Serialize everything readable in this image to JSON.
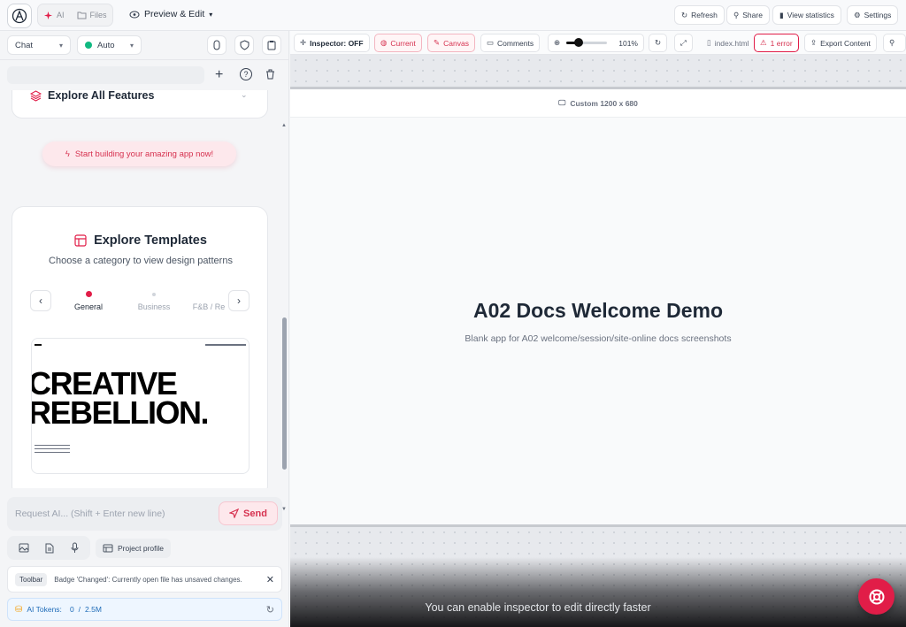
{
  "topbar": {
    "tabs": [
      "AI",
      "Files"
    ],
    "mode_label": "Preview & Edit",
    "actions": [
      "Refresh",
      "Share",
      "View statistics",
      "Settings"
    ]
  },
  "sidebar": {
    "chat_select": "Chat",
    "model_select": "Auto",
    "explore_features": "Explore All Features",
    "start_banner": "Start building your amazing app now!",
    "templates": {
      "title": "Explore Templates",
      "subtitle": "Choose a category to view design patterns",
      "categories": [
        "General",
        "Business",
        "F&B / Re"
      ],
      "preview_line1": "CREATIVE",
      "preview_line2": "REBELLION."
    },
    "input_placeholder": "Request AI... (Shift + Enter new line)",
    "send_label": "Send",
    "project_profile": "Project profile",
    "notice_tag": "Toolbar",
    "notice_text": "Badge 'Changed': Currently open file has unsaved changes.",
    "tokens_label": "AI Tokens:",
    "tokens_used": "0",
    "tokens_sep": "/",
    "tokens_total": "2.5M"
  },
  "main": {
    "inspector": "Inspector: OFF",
    "current": "Current",
    "canvas_btn": "Canvas",
    "comments": "Comments",
    "zoom": "101%",
    "zoom_level": 0.3,
    "file": "index.html",
    "error": "1 error",
    "export": "Export Content",
    "canvas_size": "Custom 1200 x 680",
    "page_title": "A02 Docs Welcome Demo",
    "page_subtitle": "Blank app for A02 welcome/session/site-online docs screenshots",
    "hint": "You can enable inspector to edit directly faster"
  },
  "colors": {
    "accent": "#e11d48",
    "token_blue": "#1e6bb8"
  }
}
